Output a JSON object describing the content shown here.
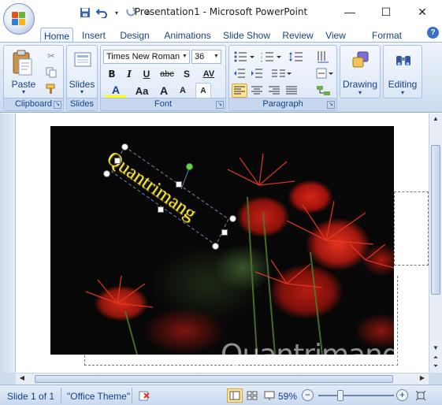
{
  "window": {
    "title": "Presentation1 - Microsoft PowerPoint",
    "minimize_glyph": "—",
    "maximize_glyph": "☐",
    "close_glyph": "✕"
  },
  "quick_access": {
    "icons": [
      "save-icon",
      "undo-icon",
      "redo-icon",
      "customize-icon"
    ]
  },
  "tabs": [
    "Home",
    "Insert",
    "Design",
    "Animations",
    "Slide Show",
    "Review",
    "View",
    "Format"
  ],
  "active_tab": "Home",
  "help_label": "?",
  "ribbon": {
    "clipboard": {
      "label": "Clipboard",
      "paste_label": "Paste",
      "paste_arrow": "▾"
    },
    "slides": {
      "label": "Slides",
      "slides_label": "Slides",
      "slides_arrow": "▾"
    },
    "font": {
      "label": "Font",
      "font_name": "Times New Roman",
      "font_size": "36",
      "bold": "B",
      "italic": "I",
      "underline": "U",
      "strike": "abc",
      "shadow": "S",
      "spacing": "AV",
      "font_color": "A",
      "change_case": "Aa",
      "grow": "A",
      "shrink": "A",
      "clear": "A"
    },
    "paragraph": {
      "label": "Paragraph"
    },
    "drawing": {
      "label": "Drawing",
      "arrow": "▾"
    },
    "editing": {
      "label": "Editing",
      "arrow": "▾"
    }
  },
  "slide": {
    "textbox_text": "Quantrimang",
    "textbox_color": "#f5e63a",
    "watermark": "Quantrimang"
  },
  "status": {
    "slide_info": "Slide 1 of 1",
    "theme": "\"Office Theme\"",
    "zoom": "59%",
    "zoom_level": 0.59,
    "minus": "−",
    "plus": "+"
  },
  "colors": {
    "accent": "#15428b",
    "ribbon": "#dbe7f6",
    "rotation_handle": "#6ad24d"
  }
}
